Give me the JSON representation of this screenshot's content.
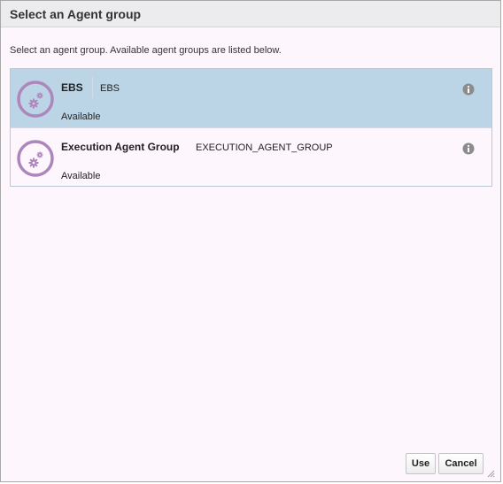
{
  "dialog": {
    "title": "Select an Agent group",
    "instructions": "Select an agent group. Available agent groups are listed below."
  },
  "agent_groups": [
    {
      "name": "EBS",
      "code": "EBS",
      "status": "Available",
      "selected": true,
      "icon": "agent-group-gears-icon"
    },
    {
      "name": "Execution Agent Group",
      "code": "EXECUTION_AGENT_GROUP",
      "status": "Available",
      "selected": false,
      "icon": "agent-group-gears-icon"
    }
  ],
  "buttons": {
    "use": "Use",
    "cancel": "Cancel"
  },
  "colors": {
    "selected_row": "#bcd5e6",
    "icon_accent": "#ad86bd",
    "dialog_background": "#fdf6fd",
    "info_icon": "#8c8c8c"
  }
}
